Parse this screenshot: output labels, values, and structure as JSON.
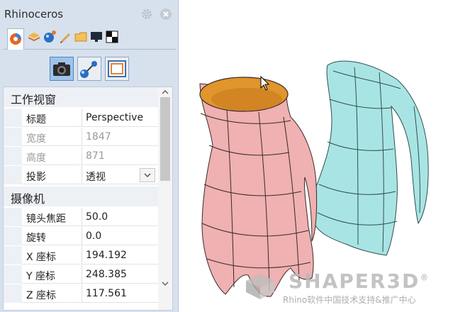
{
  "window": {
    "title": "Rhinoceros"
  },
  "colors": {
    "panel_bg": "#d7e1ee",
    "selected_button": "#9fc4ea",
    "vase_pink": "#efb1b1",
    "vase_cyan": "#a9e4e4",
    "interior": "#e0952d"
  },
  "tabs": [
    "properties-icon",
    "layers-icon",
    "render-icon",
    "pencil-icon",
    "folder-icon",
    "display-icon",
    "checker-icon"
  ],
  "props": {
    "viewport_section": "工作视窗",
    "camera_section": "摄像机",
    "rows": [
      {
        "label": "标题",
        "value": "Perspective"
      },
      {
        "label": "宽度",
        "value": "1847"
      },
      {
        "label": "高度",
        "value": "871"
      },
      {
        "label": "投影",
        "value": "透视"
      },
      {
        "label": "镜头焦距",
        "value": "50.0"
      },
      {
        "label": "旋转",
        "value": "0.0"
      },
      {
        "label": "X 座标",
        "value": "194.192"
      },
      {
        "label": "Y 座标",
        "value": "248.385"
      },
      {
        "label": "Z 座标",
        "value": "117.561"
      }
    ]
  },
  "watermark": {
    "brand": "SHAPER3D",
    "registered": "®",
    "subtitle": "Rhino软件中国技术支持&推广中心"
  }
}
